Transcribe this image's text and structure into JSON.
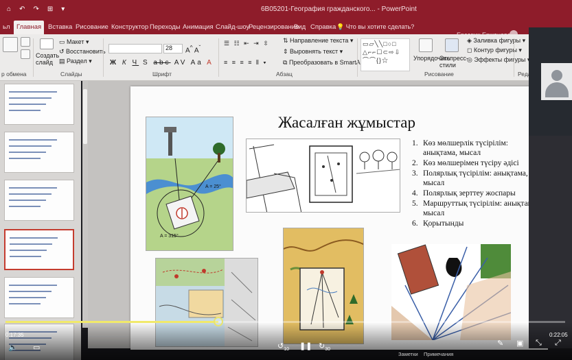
{
  "window": {
    "title": "6B05201-География гражданского... - PowerPoint",
    "user_name": "Ерсерик Ержанова",
    "quick_access": [
      "⌂",
      "↶",
      "↷",
      "⊞",
      "▾"
    ]
  },
  "tabs": {
    "file": "ьл",
    "items": [
      "Главная",
      "Вставка",
      "Рисование",
      "Конструктор",
      "Переходы",
      "Анимация",
      "Слайд-шоу",
      "Рецензирование",
      "Вид",
      "Справка"
    ],
    "active_index": 0,
    "tell_me": "Что вы хотите сделать?"
  },
  "ribbon": {
    "clipboard_label": "р обмена",
    "create_slide": "Создать слайд",
    "layout": "Макет",
    "reset": "Восстановить",
    "section": "Раздел",
    "slides_label": "Слайды",
    "font_size": "28",
    "font_label": "Шрифт",
    "font_buttons": [
      "Ж",
      "К",
      "Ч",
      "S",
      "abc",
      "AV",
      "Aa",
      "A"
    ],
    "text_direction": "Направление текста",
    "align_text": "Выровнять текст",
    "smartart": "Преобразовать в SmartArt",
    "paragraph_label": "Абзац",
    "arrange": "Упорядочить",
    "quick_styles": "Экспресс-стили",
    "shape_fill": "Заливка фигуры",
    "shape_outline": "Контур фигуры",
    "shape_effects": "Эффекты фигуры",
    "drawing_label": "Рисование",
    "edit_label": "Редакти",
    "shapes_row1": "▭▱╲╲□○□",
    "shapes_row2": "△⌐⌐☐⊂⇨⇩",
    "shapes_row3": "⌒⌒{}☆"
  },
  "thumbnails": [
    {
      "num": "",
      "selected": false
    },
    {
      "num": "",
      "selected": false
    },
    {
      "num": "",
      "selected": false
    },
    {
      "num": "",
      "selected": true
    },
    {
      "num": "",
      "selected": false
    },
    {
      "num": "",
      "selected": false
    }
  ],
  "slide": {
    "title": "Жасалған жұмыстар",
    "items": [
      {
        "num": "1.",
        "text": "Көз мөлшерлік түсірілім: анықтама, мысал"
      },
      {
        "num": "2.",
        "text": "Көз мөлшерімен түсіру әдісі"
      },
      {
        "num": "3.",
        "text": "Полярлық түсірілім: анықтама, мысал"
      },
      {
        "num": "4.",
        "text": "Полярлық зерттеу жоспары"
      },
      {
        "num": "5.",
        "text": "Маршруттық түсірілім: анықтама, мысал"
      },
      {
        "num": "6.",
        "text": "Қорытынды"
      }
    ],
    "angle_label_1": "A = 25°",
    "angle_label_2": "A = 315°"
  },
  "player": {
    "elapsed": "0:17:35",
    "remaining": "0:22:05",
    "progress": 0.38,
    "skip_back": "10",
    "skip_forward": "30",
    "notes_label": "Заметки",
    "comments_label": "Примечания"
  },
  "colors": {
    "accent": "#8e1c2a",
    "selection": "#c43b2e",
    "progress": "#f1e96a"
  }
}
